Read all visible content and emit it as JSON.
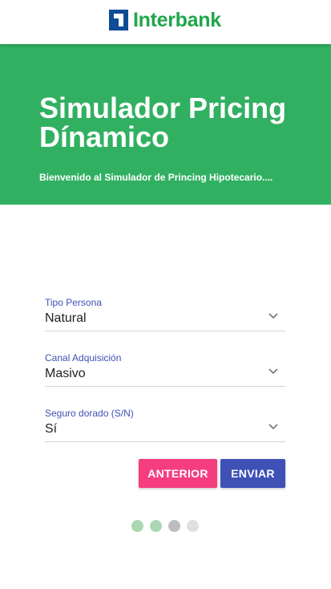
{
  "header": {
    "brand_name": "Interbank",
    "colors": {
      "brand_green": "#20a64b",
      "brand_blue": "#0e4c96"
    },
    "logo_icon": "interbank-logo-icon"
  },
  "hero": {
    "title": "Simulador Pricing Dínamico",
    "subtitle": "Bienvenido al Simulador de Princing Hipotecario....",
    "background_color": "#31b062"
  },
  "form": {
    "fields": [
      {
        "label": "Tipo Persona",
        "value": "Natural",
        "icon": "chevron-down-icon"
      },
      {
        "label": "Canal Adquisición",
        "value": "Masivo",
        "icon": "chevron-down-icon"
      },
      {
        "label": "Seguro dorado (S/N)",
        "value": "Sí",
        "icon": "chevron-down-icon"
      }
    ],
    "label_color": "#3f51b5"
  },
  "actions": {
    "previous_label": "ANTERIOR",
    "submit_label": "ENVIAR",
    "colors": {
      "previous": "#f53d7f",
      "submit": "#3f51b5"
    }
  },
  "stepper": {
    "total_steps": 4,
    "completed_steps": 2,
    "current_step": 3,
    "colors": {
      "completed": "#a9d8b2",
      "current": "#bdbdbd",
      "pending": "#e0e0e0"
    }
  }
}
